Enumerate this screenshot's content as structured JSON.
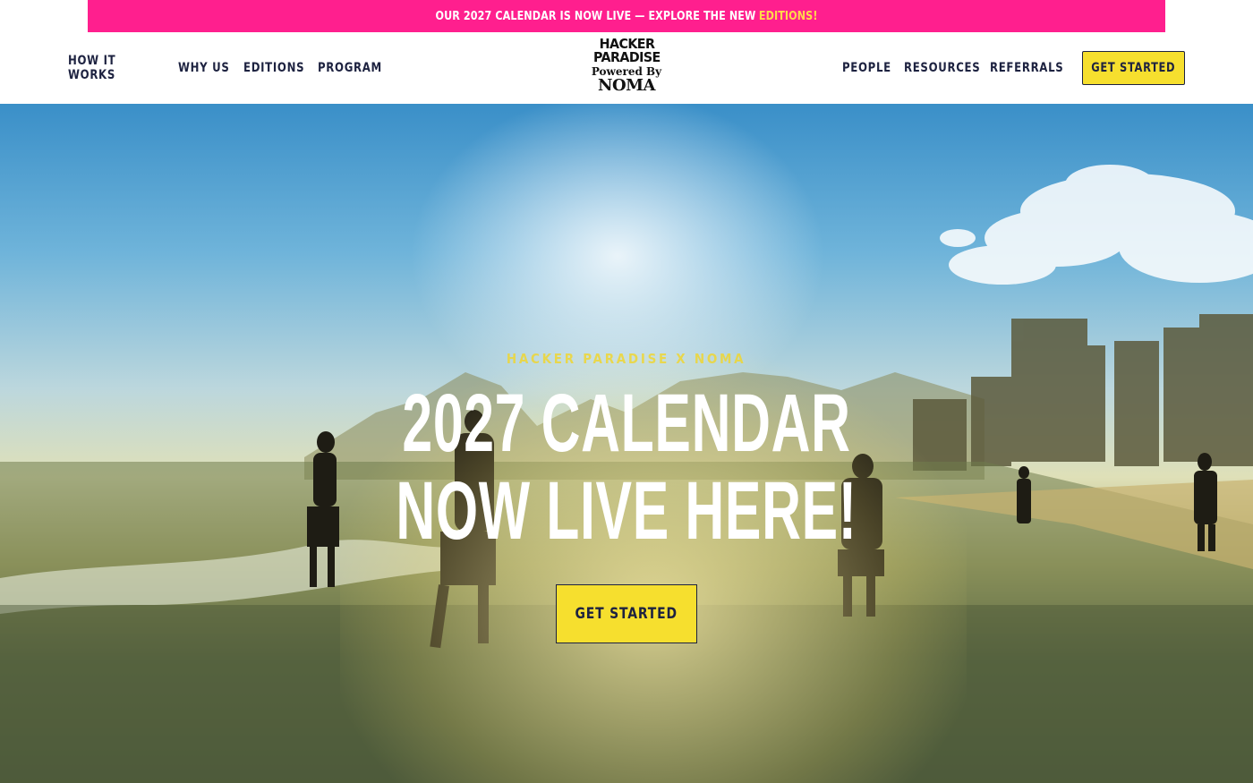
{
  "announcement": {
    "text": "OUR 2027 CALENDAR IS NOW LIVE — EXPLORE THE NEW",
    "link_text": "EDITIONS!",
    "background": "#ff1f8e",
    "link_color": "#ffd84a"
  },
  "nav": {
    "left": [
      "HOW IT WORKS",
      "WHY US",
      "EDITIONS",
      "PROGRAM"
    ],
    "right": [
      "PEOPLE",
      "RESOURCES",
      "REFERRALS"
    ],
    "cta_label": "GET STARTED"
  },
  "logo": {
    "line1": "HACKER",
    "line2": "PARADISE",
    "line3": "Powered By",
    "line4": "NOMA"
  },
  "hero": {
    "eyebrow": "HACKER PARADISE X NOMA",
    "headline_line1": "2027 CALENDAR",
    "headline_line2": "NOW LIVE HERE!",
    "cta_label": "GET STARTED",
    "background_image": "beach-sunset-photo"
  },
  "colors": {
    "accent_yellow": "#f6df2e",
    "navy": "#1d2240",
    "pink": "#ff1f8e"
  }
}
